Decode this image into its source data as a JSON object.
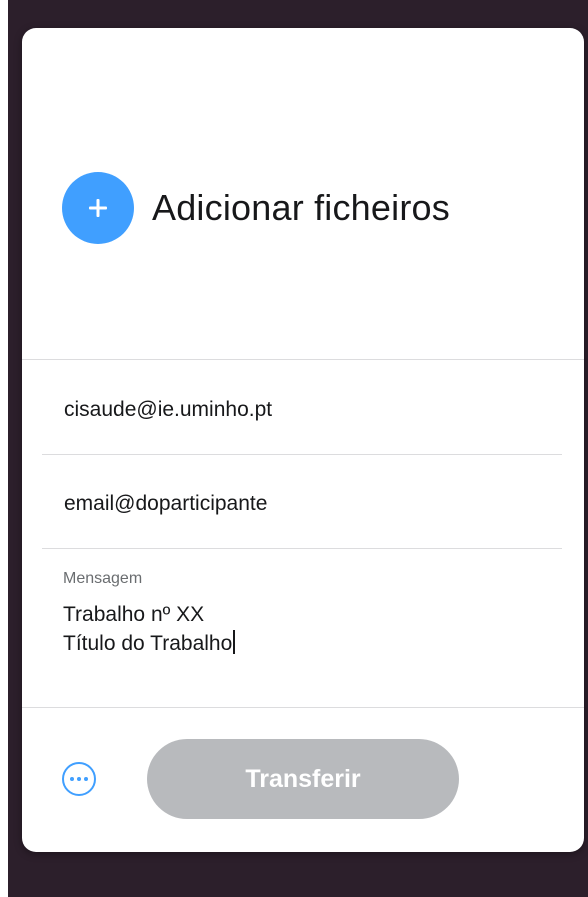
{
  "add_files": {
    "label": "Adicionar ficheiros",
    "icon": "plus-icon"
  },
  "form": {
    "to_value": "cisaude@ie.uminho.pt",
    "from_value": "email@doparticipante",
    "message_label": "Mensagem",
    "message_lines": [
      "Trabalho nº XX",
      "Título do Trabalho"
    ]
  },
  "footer": {
    "more_icon": "more-options-icon",
    "transfer_label": "Transferir"
  },
  "colors": {
    "accent": "#409fff",
    "button_disabled": "#b8babd",
    "background": "#2c1f2b"
  }
}
